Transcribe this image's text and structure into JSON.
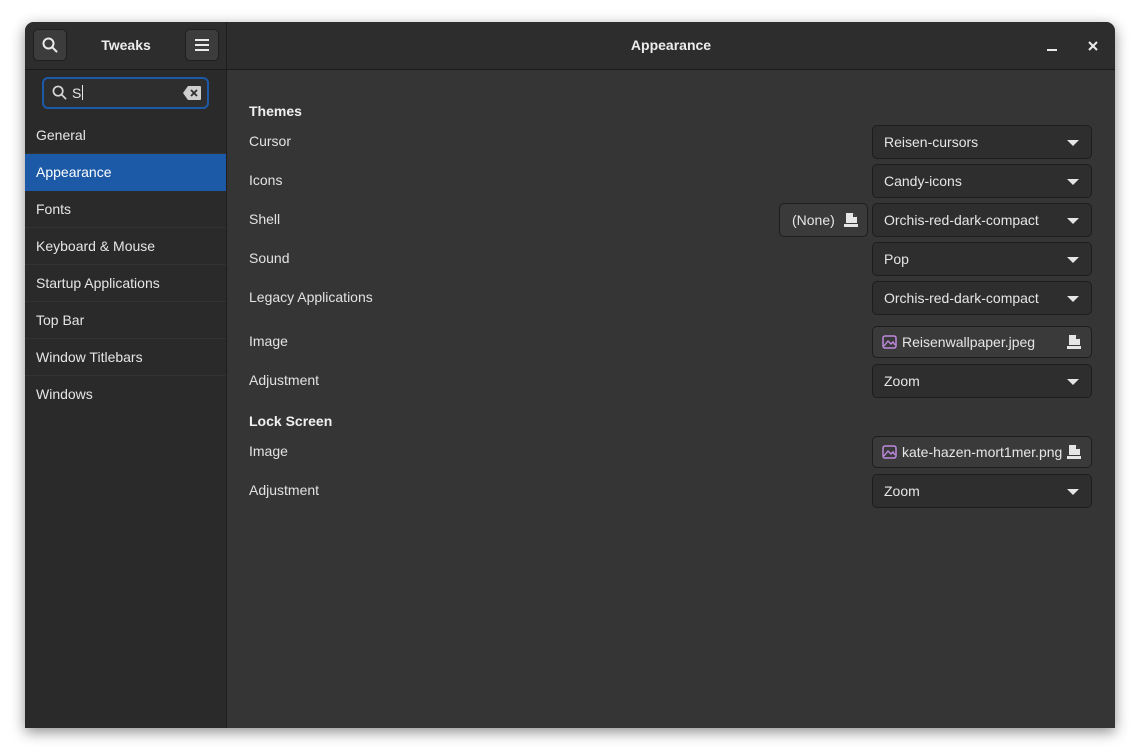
{
  "sidebar": {
    "title": "Tweaks",
    "search": {
      "value": "S"
    },
    "items": [
      {
        "label": "General"
      },
      {
        "label": "Appearance"
      },
      {
        "label": "Fonts"
      },
      {
        "label": "Keyboard & Mouse"
      },
      {
        "label": "Startup Applications"
      },
      {
        "label": "Top Bar"
      },
      {
        "label": "Window Titlebars"
      },
      {
        "label": "Windows"
      }
    ],
    "selected": "Appearance"
  },
  "header": {
    "title": "Appearance"
  },
  "themes": {
    "title": "Themes",
    "cursor": {
      "label": "Cursor",
      "value": "Reisen-cursors"
    },
    "icons": {
      "label": "Icons",
      "value": "Candy-icons"
    },
    "shell": {
      "label": "Shell",
      "file": "(None)",
      "value": "Orchis-red-dark-compact"
    },
    "sound": {
      "label": "Sound",
      "value": "Pop"
    },
    "legacy": {
      "label": "Legacy Applications",
      "value": "Orchis-red-dark-compact"
    }
  },
  "background": {
    "image": {
      "label": "Image",
      "value": "Reisenwallpaper.jpeg"
    },
    "adjustment": {
      "label": "Adjustment",
      "value": "Zoom"
    }
  },
  "lockscreen": {
    "title": "Lock Screen",
    "image": {
      "label": "Image",
      "value": "kate-hazen-mort1mer.png"
    },
    "adjustment": {
      "label": "Adjustment",
      "value": "Zoom"
    }
  },
  "colors": {
    "accent": "#1c5aa8",
    "window_bg": "#353535",
    "sidebar_bg": "#2a2a2a",
    "image_icon": "#c08ae0"
  }
}
